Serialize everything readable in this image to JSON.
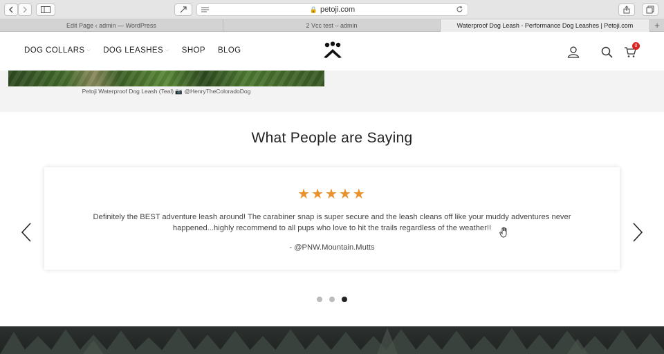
{
  "browser": {
    "url": "petoji.com",
    "tabs": [
      {
        "label": "Edit Page ‹ admin — WordPress",
        "active": false
      },
      {
        "label": "2 Vcc test – admin",
        "active": false
      },
      {
        "label": "Waterproof Dog Leash - Performance Dog Leashes | Petoji.com",
        "active": true
      }
    ]
  },
  "nav": {
    "items": [
      {
        "label": "DOG COLLARS",
        "has_dropdown": true
      },
      {
        "label": "DOG LEASHES",
        "has_dropdown": true
      },
      {
        "label": "SHOP",
        "has_dropdown": false
      },
      {
        "label": "BLOG",
        "has_dropdown": false
      }
    ],
    "cart_count": "0"
  },
  "photo": {
    "caption": "Petoji Waterproof Dog Leash (Teal) 📷 @HenryTheColoradoDog"
  },
  "testimonials": {
    "title": "What People are Saying",
    "rating": 5,
    "stars": "★★★★★",
    "quote": "Definitely the BEST adventure leash around! The carabiner snap is super secure and the leash cleans off like your muddy adventures never happened...highly recommend to all pups who love to hit the trails regardless of the weather!!",
    "author": "- @PNW.Mountain.Mutts",
    "slide_count": 3,
    "active_slide": 3
  },
  "colors": {
    "star": "#e8912d",
    "cart_badge": "#d92121"
  }
}
